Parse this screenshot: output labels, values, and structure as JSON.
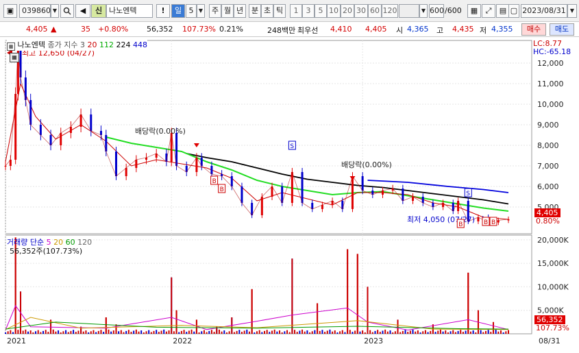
{
  "toolbar": {
    "code": "039860",
    "badge": "신",
    "stock_name": "나노엔텍",
    "period_selected": "일",
    "period_num": "5",
    "periods": [
      "주",
      "월",
      "년",
      "분",
      "초",
      "틱"
    ],
    "intervals": [
      "1",
      "3",
      "5",
      "10",
      "20",
      "30",
      "60",
      "120"
    ],
    "count": "600",
    "count_total": "/600",
    "date": "2023/08/31"
  },
  "quote": {
    "price": "4,405",
    "change": "35",
    "change_pct": "+0.80%",
    "volume": "56,352",
    "vol_ratio": "107.73%",
    "turnover": "0.21%",
    "amount": "248백만",
    "best_ask_label": "최우선",
    "best_ask": "4,410",
    "best_bid": "4,405",
    "open_label": "시",
    "open": "4,365",
    "high_label": "고",
    "high": "4,435",
    "low_label": "저",
    "low": "4,355",
    "buy_label": "매수",
    "sell_label": "매도"
  },
  "price_panel": {
    "name": "나노엔텍",
    "ma_label": "종가 지수 3",
    "ma": [
      {
        "period": "20",
        "color": "#cc0000"
      },
      {
        "period": "112",
        "color": "#00cc00"
      },
      {
        "period": "224",
        "color": "#000000"
      },
      {
        "period": "448",
        "color": "#0000cc"
      }
    ],
    "high_text": "최고 12,650 (04/27)",
    "low_text": "최저 4,050 (07/27)",
    "lc": "LC:8.77",
    "hc": "HC:-65.18",
    "current_price": "4,405",
    "current_pct": "0.80%",
    "dividend_labels": [
      "배당락(0.00%)",
      "배당락(0.00%)"
    ],
    "y_ticks": [
      "12,000",
      "11,000",
      "10,000",
      "9,000",
      "8,000",
      "7,000",
      "6,000",
      "5,000"
    ]
  },
  "volume_panel": {
    "title": "거래량 단순",
    "ma": [
      {
        "period": "5",
        "color": "#cc00cc"
      },
      {
        "period": "20",
        "color": "#cc9900"
      },
      {
        "period": "60",
        "color": "#009900"
      },
      {
        "period": "120",
        "color": "#666666"
      }
    ],
    "current_text": "56,352주(107.73%)",
    "current_vol": "56,352",
    "current_pct": "107.73%",
    "y_ticks": [
      "20,000K",
      "15,000K",
      "10,000K",
      "5,000K"
    ]
  },
  "x_axis": {
    "labels": [
      "2021",
      "2022",
      "2023",
      "08/31"
    ]
  },
  "chart_data": {
    "type": "candlestick",
    "x_range": [
      "2021-01",
      "2023-08-31"
    ],
    "ylim": [
      3700,
      13100
    ],
    "price_series": [
      {
        "t": 0.0,
        "v": 7000
      },
      {
        "t": 0.01,
        "v": 7300
      },
      {
        "t": 0.02,
        "v": 10500
      },
      {
        "t": 0.025,
        "v": 12650
      },
      {
        "t": 0.03,
        "v": 11300
      },
      {
        "t": 0.04,
        "v": 10200
      },
      {
        "t": 0.05,
        "v": 9000
      },
      {
        "t": 0.07,
        "v": 8500
      },
      {
        "t": 0.09,
        "v": 8000
      },
      {
        "t": 0.11,
        "v": 8600
      },
      {
        "t": 0.13,
        "v": 8900
      },
      {
        "t": 0.15,
        "v": 9500
      },
      {
        "t": 0.17,
        "v": 8700
      },
      {
        "t": 0.19,
        "v": 8500
      },
      {
        "t": 0.2,
        "v": 7700
      },
      {
        "t": 0.22,
        "v": 6500
      },
      {
        "t": 0.24,
        "v": 6900
      },
      {
        "t": 0.26,
        "v": 7300
      },
      {
        "t": 0.28,
        "v": 7400
      },
      {
        "t": 0.3,
        "v": 7600
      },
      {
        "t": 0.32,
        "v": 7200
      },
      {
        "t": 0.33,
        "v": 8600
      },
      {
        "t": 0.34,
        "v": 7000
      },
      {
        "t": 0.36,
        "v": 6700
      },
      {
        "t": 0.38,
        "v": 7400
      },
      {
        "t": 0.39,
        "v": 7000
      },
      {
        "t": 0.41,
        "v": 6600
      },
      {
        "t": 0.43,
        "v": 6500
      },
      {
        "t": 0.45,
        "v": 6000
      },
      {
        "t": 0.47,
        "v": 5200
      },
      {
        "t": 0.49,
        "v": 4600
      },
      {
        "t": 0.51,
        "v": 5500
      },
      {
        "t": 0.53,
        "v": 6000
      },
      {
        "t": 0.55,
        "v": 5200
      },
      {
        "t": 0.57,
        "v": 6700
      },
      {
        "t": 0.59,
        "v": 5200
      },
      {
        "t": 0.61,
        "v": 4900
      },
      {
        "t": 0.63,
        "v": 5100
      },
      {
        "t": 0.65,
        "v": 5300
      },
      {
        "t": 0.67,
        "v": 4900
      },
      {
        "t": 0.69,
        "v": 6500
      },
      {
        "t": 0.71,
        "v": 5800
      },
      {
        "t": 0.73,
        "v": 5600
      },
      {
        "t": 0.75,
        "v": 5800
      },
      {
        "t": 0.77,
        "v": 5900
      },
      {
        "t": 0.79,
        "v": 5300
      },
      {
        "t": 0.81,
        "v": 5500
      },
      {
        "t": 0.83,
        "v": 5200
      },
      {
        "t": 0.85,
        "v": 5000
      },
      {
        "t": 0.87,
        "v": 5200
      },
      {
        "t": 0.89,
        "v": 4800
      },
      {
        "t": 0.9,
        "v": 5300
      },
      {
        "t": 0.92,
        "v": 4300
      },
      {
        "t": 0.94,
        "v": 4500
      },
      {
        "t": 0.96,
        "v": 4250
      },
      {
        "t": 0.98,
        "v": 4350
      },
      {
        "t": 1.0,
        "v": 4405
      }
    ],
    "ma20": [
      [
        0.0,
        7200
      ],
      [
        0.03,
        11000
      ],
      [
        0.06,
        9400
      ],
      [
        0.1,
        8300
      ],
      [
        0.15,
        9000
      ],
      [
        0.2,
        8200
      ],
      [
        0.25,
        7000
      ],
      [
        0.3,
        7300
      ],
      [
        0.35,
        7100
      ],
      [
        0.4,
        6900
      ],
      [
        0.45,
        6400
      ],
      [
        0.5,
        5300
      ],
      [
        0.55,
        5700
      ],
      [
        0.6,
        5400
      ],
      [
        0.65,
        5100
      ],
      [
        0.7,
        5700
      ],
      [
        0.75,
        5700
      ],
      [
        0.8,
        5600
      ],
      [
        0.85,
        5200
      ],
      [
        0.9,
        5000
      ],
      [
        0.95,
        4500
      ],
      [
        1.0,
        4400
      ]
    ],
    "ma112": [
      [
        0.2,
        8400
      ],
      [
        0.25,
        8100
      ],
      [
        0.3,
        7900
      ],
      [
        0.35,
        7700
      ],
      [
        0.4,
        7200
      ],
      [
        0.45,
        6800
      ],
      [
        0.5,
        6300
      ],
      [
        0.55,
        6000
      ],
      [
        0.6,
        5800
      ],
      [
        0.65,
        5600
      ],
      [
        0.7,
        5700
      ],
      [
        0.75,
        5750
      ],
      [
        0.8,
        5550
      ],
      [
        0.85,
        5350
      ],
      [
        0.9,
        5150
      ],
      [
        0.95,
        4950
      ],
      [
        1.0,
        4800
      ]
    ],
    "ma224": [
      [
        0.36,
        7600
      ],
      [
        0.4,
        7400
      ],
      [
        0.45,
        7200
      ],
      [
        0.5,
        6900
      ],
      [
        0.55,
        6600
      ],
      [
        0.6,
        6350
      ],
      [
        0.65,
        6200
      ],
      [
        0.7,
        6050
      ],
      [
        0.75,
        5950
      ],
      [
        0.8,
        5800
      ],
      [
        0.85,
        5650
      ],
      [
        0.9,
        5500
      ],
      [
        0.95,
        5350
      ],
      [
        1.0,
        5150
      ]
    ],
    "ma448": [
      [
        0.72,
        6300
      ],
      [
        0.8,
        6200
      ],
      [
        0.88,
        6000
      ],
      [
        0.95,
        5850
      ],
      [
        1.0,
        5700
      ]
    ],
    "volume_ylim": [
      0,
      21000
    ],
    "volume_spikes": [
      {
        "t": 0.02,
        "v": 20500
      },
      {
        "t": 0.03,
        "v": 9000
      },
      {
        "t": 0.09,
        "v": 3000
      },
      {
        "t": 0.15,
        "v": 1500
      },
      {
        "t": 0.2,
        "v": 3500
      },
      {
        "t": 0.22,
        "v": 2000
      },
      {
        "t": 0.33,
        "v": 12000
      },
      {
        "t": 0.34,
        "v": 5000
      },
      {
        "t": 0.38,
        "v": 3000
      },
      {
        "t": 0.42,
        "v": 1500
      },
      {
        "t": 0.45,
        "v": 3500
      },
      {
        "t": 0.49,
        "v": 9500
      },
      {
        "t": 0.57,
        "v": 16000
      },
      {
        "t": 0.62,
        "v": 6500
      },
      {
        "t": 0.68,
        "v": 18000
      },
      {
        "t": 0.7,
        "v": 17000
      },
      {
        "t": 0.72,
        "v": 10000
      },
      {
        "t": 0.78,
        "v": 3000
      },
      {
        "t": 0.85,
        "v": 2000
      },
      {
        "t": 0.92,
        "v": 13000
      },
      {
        "t": 0.94,
        "v": 5000
      },
      {
        "t": 0.97,
        "v": 2500
      }
    ]
  }
}
